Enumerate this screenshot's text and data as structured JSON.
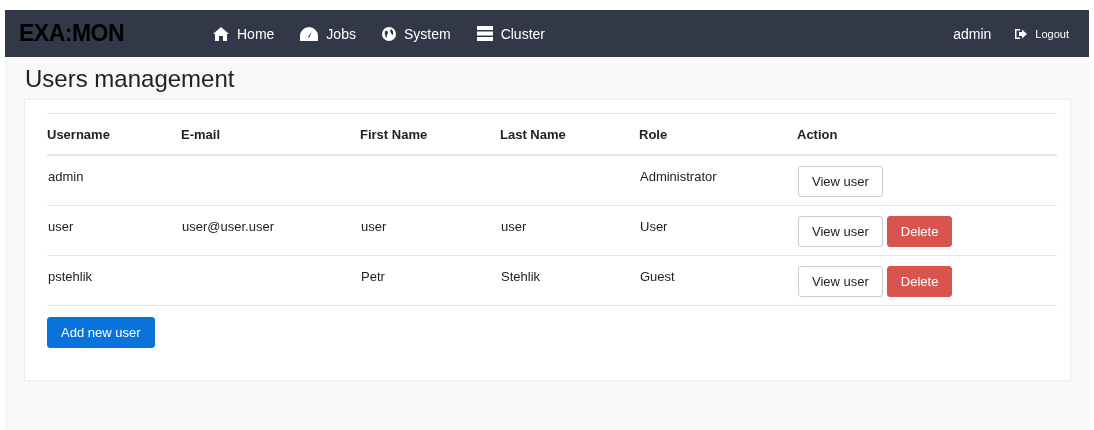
{
  "navbar": {
    "logo": "EXA:MON",
    "links": [
      {
        "label": "Home",
        "kind": "home"
      },
      {
        "label": "Jobs",
        "kind": "dashboard"
      },
      {
        "label": "System",
        "kind": "system"
      },
      {
        "label": "Cluster",
        "kind": "cluster"
      }
    ],
    "user": "admin",
    "logout": "Logout"
  },
  "page_title": "Users management",
  "table": {
    "columns": [
      "Username",
      "E-mail",
      "First Name",
      "Last Name",
      "Role",
      "Action"
    ],
    "rows": [
      {
        "cells": [
          "admin",
          "",
          "",
          "",
          "Administrator"
        ],
        "actions": [
          "View user"
        ]
      },
      {
        "cells": [
          "user",
          "user@user.user",
          "user",
          "user",
          "User"
        ],
        "actions": [
          "View user",
          "Delete"
        ]
      },
      {
        "cells": [
          "pstehlik",
          "",
          "Petr",
          "Stehlik",
          "Guest"
        ],
        "actions": [
          "View user",
          "Delete"
        ]
      }
    ]
  },
  "add_button": "Add new user"
}
